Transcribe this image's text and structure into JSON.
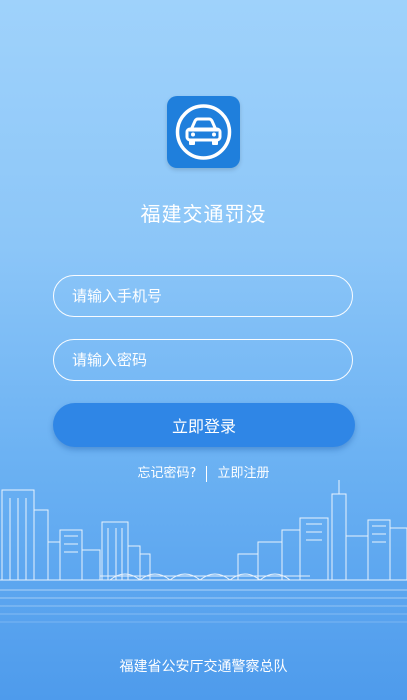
{
  "app": {
    "title": "福建交通罚没",
    "logo_icon": "car-icon",
    "logo_color": "#1f7fdc"
  },
  "form": {
    "phone_placeholder": "请输入手机号",
    "phone_value": "",
    "password_placeholder": "请输入密码",
    "password_value": "",
    "login_label": "立即登录"
  },
  "links": {
    "forgot_password": "忘记密码?",
    "register": "立即注册"
  },
  "footer": {
    "text": "福建省公安厅交通警察总队"
  },
  "colors": {
    "accent": "#2f86e6",
    "background_top": "#9fd2fb",
    "background_bottom": "#4e9bec"
  }
}
